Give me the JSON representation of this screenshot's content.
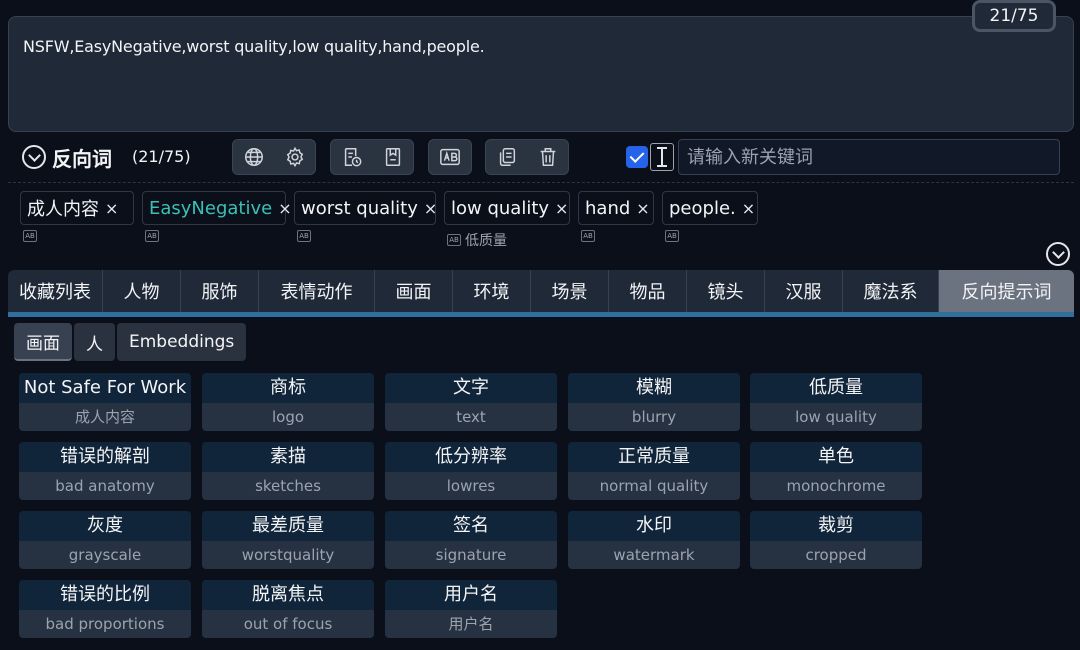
{
  "prompt": {
    "text": "NSFW,EasyNegative,worst quality,low quality,hand,people.",
    "counter": "21/75"
  },
  "toolbar": {
    "title": "反向词",
    "count": "(21/75)",
    "input_placeholder": "请输入新关键词",
    "checkbox_checked": true,
    "icons": [
      "globe-icon",
      "gear-icon",
      "history-file-icon",
      "bookmark-icon",
      "translate-icon",
      "copy-icon",
      "trash-icon"
    ]
  },
  "tags": [
    {
      "text": "成人内容",
      "trans": "",
      "accent": false
    },
    {
      "text": "EasyNegative",
      "trans": "",
      "accent": true
    },
    {
      "text": "worst quality",
      "trans": "",
      "accent": false
    },
    {
      "text": "low quality",
      "trans": "低质量",
      "accent": false
    },
    {
      "text": "hand",
      "trans": "",
      "accent": false
    },
    {
      "text": "people.",
      "trans": "",
      "accent": false
    }
  ],
  "tag_close": "×",
  "translate_glyph": "AB",
  "categories": [
    "收藏列表",
    "人物",
    "服饰",
    "表情动作",
    "画面",
    "环境",
    "场景",
    "物品",
    "镜头",
    "汉服",
    "魔法系",
    "反向提示词"
  ],
  "active_category": "反向提示词",
  "subtabs": [
    "画面",
    "人",
    "Embeddings"
  ],
  "active_subtab": "画面",
  "cards": [
    {
      "zh": "Not Safe For Work",
      "en": "成人内容"
    },
    {
      "zh": "商标",
      "en": "logo"
    },
    {
      "zh": "文字",
      "en": "text"
    },
    {
      "zh": "模糊",
      "en": "blurry"
    },
    {
      "zh": "低质量",
      "en": "low quality"
    },
    {
      "zh": "错误的解剖",
      "en": "bad anatomy"
    },
    {
      "zh": "素描",
      "en": "sketches"
    },
    {
      "zh": "低分辨率",
      "en": "lowres"
    },
    {
      "zh": "正常质量",
      "en": "normal quality"
    },
    {
      "zh": "单色",
      "en": "monochrome"
    },
    {
      "zh": "灰度",
      "en": "grayscale"
    },
    {
      "zh": "最差质量",
      "en": "worstquality"
    },
    {
      "zh": "签名",
      "en": "signature"
    },
    {
      "zh": "水印",
      "en": "watermark"
    },
    {
      "zh": "裁剪",
      "en": "cropped"
    },
    {
      "zh": "错误的比例",
      "en": "bad proportions"
    },
    {
      "zh": "脱离焦点",
      "en": "out of focus"
    },
    {
      "zh": "用户名",
      "en": "用户名"
    }
  ]
}
